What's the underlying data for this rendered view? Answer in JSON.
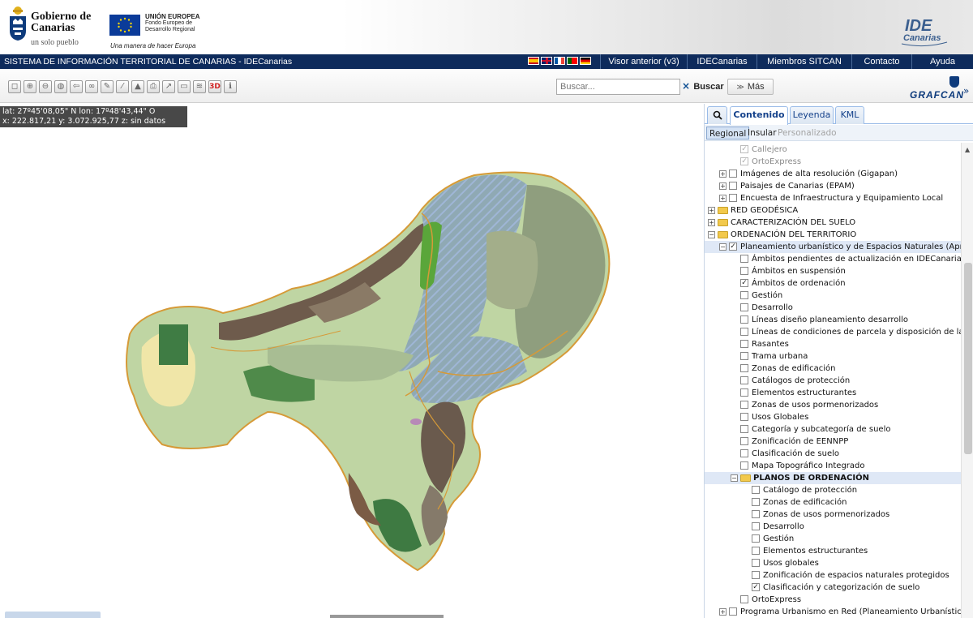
{
  "header": {
    "gobierno_name": "Gobierno de Canarias",
    "gobierno_tagline": "un solo pueblo",
    "eu_title": "UNIÓN EUROPEA",
    "eu_fund": "Fondo Europeo de Desarrollo Regional",
    "eu_motto": "Una manera de hacer Europa",
    "ide_logo_line1": "IDE",
    "ide_logo_line2": "Canarias"
  },
  "topbar": {
    "system_title": "SISTEMA DE INFORMACIÓN TERRITORIAL DE CANARIAS - IDECanarias",
    "flags": [
      "spain-flag-icon",
      "uk-flag-icon",
      "france-flag-icon",
      "portugal-flag-icon",
      "germany-flag-icon"
    ],
    "nav": [
      "Visor anterior (v3)",
      "IDECanarias",
      "Miembros SITCAN",
      "Contacto",
      "Ayuda"
    ]
  },
  "toolbar": {
    "tools": [
      "extent-icon",
      "zoom-in-icon",
      "zoom-out-icon",
      "globe-icon",
      "back-icon",
      "link-icon",
      "draw-icon",
      "measure-icon",
      "profile-icon",
      "print-icon",
      "export-icon",
      "rule-icon",
      "layers-icon",
      "3d-icon",
      "info-icon"
    ],
    "tool_3d_label": "3D",
    "search_placeholder": "Buscar...",
    "clear_label": "×",
    "search_button": "Buscar",
    "more_button": "Más",
    "grafcan": "GRAFCAN"
  },
  "map": {
    "coords_line1": "lat: 27º45'08,05\" N  lon: 17º48'43,44\" O",
    "coords_line2": "x: 222.817,21  y: 3.072.925,77  z: sin datos"
  },
  "panel": {
    "tabs": [
      "Contenido",
      "Leyenda",
      "KML"
    ],
    "subtabs": [
      "Regional",
      "Insular",
      "Personalizado"
    ],
    "tree": [
      {
        "label": "Callejero",
        "indent": 3,
        "cb": "dimchecked",
        "exp": false,
        "folder": false,
        "dim": true
      },
      {
        "label": "OrtoExpress",
        "indent": 3,
        "cb": "dimchecked",
        "exp": false,
        "folder": false,
        "dim": true
      },
      {
        "label": "Imágenes de alta resolución (Gigapan)",
        "indent": 2,
        "cb": "unchecked",
        "exp": true,
        "folder": false
      },
      {
        "label": "Paisajes de Canarias (EPAM)",
        "indent": 2,
        "cb": "unchecked",
        "exp": true,
        "folder": false
      },
      {
        "label": "Encuesta de Infraestructura y Equipamiento Local",
        "indent": 2,
        "cb": "unchecked",
        "exp": true,
        "folder": false
      },
      {
        "label": "RED GEODÉSICA",
        "indent": 1,
        "cb": "none",
        "exp": true,
        "folder": true
      },
      {
        "label": "CARACTERIZACIÓN DEL SUELO",
        "indent": 1,
        "cb": "none",
        "exp": true,
        "folder": true
      },
      {
        "label": "ORDENACIÓN DEL TERRITORIO",
        "indent": 1,
        "cb": "none",
        "exp": "open",
        "folder": true
      },
      {
        "label": "Planeamiento urbanístico y de Espacios Naturales (Aprb. Def",
        "indent": 2,
        "cb": "checked",
        "exp": "open",
        "folder": false,
        "selected": true
      },
      {
        "label": "Ámbitos pendientes de actualización en IDECanarias",
        "indent": 3,
        "cb": "unchecked"
      },
      {
        "label": "Ámbitos en suspensión",
        "indent": 3,
        "cb": "unchecked"
      },
      {
        "label": "Ámbitos de ordenación",
        "indent": 3,
        "cb": "checked"
      },
      {
        "label": "Gestión",
        "indent": 3,
        "cb": "unchecked"
      },
      {
        "label": "Desarrollo",
        "indent": 3,
        "cb": "unchecked"
      },
      {
        "label": "Líneas diseño planeamiento desarrollo",
        "indent": 3,
        "cb": "unchecked"
      },
      {
        "label": "Líneas de condiciones de parcela y disposición de la edific",
        "indent": 3,
        "cb": "unchecked"
      },
      {
        "label": "Rasantes",
        "indent": 3,
        "cb": "unchecked"
      },
      {
        "label": "Trama urbana",
        "indent": 3,
        "cb": "unchecked"
      },
      {
        "label": "Zonas de edificación",
        "indent": 3,
        "cb": "unchecked"
      },
      {
        "label": "Catálogos de protección",
        "indent": 3,
        "cb": "unchecked"
      },
      {
        "label": "Elementos estructurantes",
        "indent": 3,
        "cb": "unchecked"
      },
      {
        "label": "Zonas de usos pormenorizados",
        "indent": 3,
        "cb": "unchecked"
      },
      {
        "label": "Usos Globales",
        "indent": 3,
        "cb": "unchecked"
      },
      {
        "label": "Categoría y subcategoría de suelo",
        "indent": 3,
        "cb": "unchecked"
      },
      {
        "label": "Zonificación de EENNPP",
        "indent": 3,
        "cb": "unchecked"
      },
      {
        "label": "Clasificación de suelo",
        "indent": 3,
        "cb": "unchecked"
      },
      {
        "label": "Mapa Topográfico Integrado",
        "indent": 3,
        "cb": "unchecked"
      },
      {
        "label": "PLANOS DE ORDENACIÓN",
        "indent": 3,
        "cb": "none",
        "exp": "open",
        "folder": true,
        "bold": true,
        "selected": true
      },
      {
        "label": "Catálogo de protección",
        "indent": 4,
        "cb": "unchecked"
      },
      {
        "label": "Zonas de edificación",
        "indent": 4,
        "cb": "unchecked"
      },
      {
        "label": "Zonas de usos pormenorizados",
        "indent": 4,
        "cb": "unchecked"
      },
      {
        "label": "Desarrollo",
        "indent": 4,
        "cb": "unchecked"
      },
      {
        "label": "Gestión",
        "indent": 4,
        "cb": "unchecked"
      },
      {
        "label": "Elementos estructurantes",
        "indent": 4,
        "cb": "unchecked"
      },
      {
        "label": "Usos globales",
        "indent": 4,
        "cb": "unchecked"
      },
      {
        "label": "Zonificación de espacios naturales protegidos",
        "indent": 4,
        "cb": "unchecked"
      },
      {
        "label": "Clasificación y categorización de suelo",
        "indent": 4,
        "cb": "checked"
      },
      {
        "label": "OrtoExpress",
        "indent": 3,
        "cb": "unchecked"
      },
      {
        "label": "Programa Urbanismo en Red (Planeamiento Urbanístico y de",
        "indent": 2,
        "cb": "unchecked",
        "exp": true
      }
    ]
  },
  "colors": {
    "navy": "#0e2b5c",
    "panel_blue": "#15428b",
    "map_green_light": "#b9d3a0",
    "map_green_dark": "#3e7a42",
    "map_yellow": "#f0e6a8",
    "map_hatch": "#8fa6c7",
    "boundary_orange": "#e09b2d"
  }
}
